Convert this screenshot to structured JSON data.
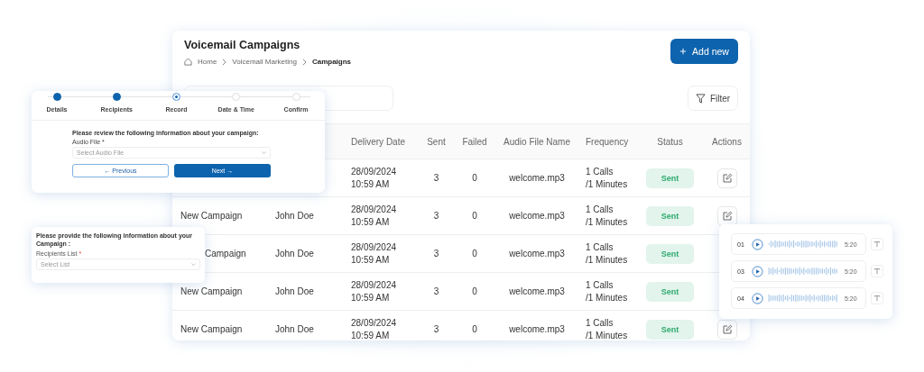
{
  "page": {
    "title": "Voicemail Campaigns",
    "breadcrumb": [
      {
        "label": "Home",
        "selected": false
      },
      {
        "label": "Voicemail  Marketing",
        "selected": false
      },
      {
        "label": "Campaigns",
        "selected": true
      }
    ],
    "add_button": "Add new",
    "filter_button": "Filter"
  },
  "table": {
    "columns": [
      "Delivery Date",
      "Sent",
      "Failed",
      "Audio File Name",
      "Frequency",
      "Status",
      "Actions"
    ],
    "rows": [
      {
        "date": "28/09/2024",
        "time": "10:59 AM",
        "sent": "3",
        "failed": "0",
        "audio": "welcome.mp3",
        "freq1": "1 Calls",
        "freq2": "/1 Minutes",
        "status": "Sent",
        "edit_shown": true
      },
      {
        "name": "New Campaign",
        "created_by": "John Doe",
        "date": "28/09/2024",
        "time": "10:59 AM",
        "sent": "3",
        "failed": "0",
        "audio": "welcome.mp3",
        "freq1": "1 Calls",
        "freq2": "/1 Minutes",
        "status": "Sent",
        "edit_shown": true
      },
      {
        "name": "Campaign",
        "name_cut": true,
        "created_by": "John Doe",
        "date": "28/09/2024",
        "time": "10:59 AM",
        "sent": "3",
        "failed": "0",
        "audio": "welcome.mp3",
        "freq1": "1 Calls",
        "freq2": "/1 Minutes",
        "status": "Sent",
        "edit_shown": false
      },
      {
        "name": "New Campaign",
        "created_by": "John Doe",
        "date": "28/09/2024",
        "time": "10:59 AM",
        "sent": "3",
        "failed": "0",
        "audio": "welcome.mp3",
        "freq1": "1 Calls",
        "freq2": "/1 Minutes",
        "status": "Sent",
        "edit_shown": false
      },
      {
        "name": "New Campaign",
        "created_by": "John Doe",
        "date": "28/09/2024",
        "time": "10:59 AM",
        "sent": "3",
        "failed": "0",
        "audio": "welcome.mp3",
        "freq1": "1 Calls",
        "freq2": "/1 Minutes",
        "status": "Sent",
        "edit_shown": true
      }
    ]
  },
  "wizard": {
    "steps": [
      {
        "label": "Details",
        "completed": true,
        "selected": false
      },
      {
        "label": "Recipients",
        "completed": true,
        "selected": false
      },
      {
        "label": "Record",
        "completed": false,
        "selected": true
      },
      {
        "label": "Date & Time",
        "completed": false,
        "selected": false
      },
      {
        "label": "Confirm",
        "completed": false,
        "selected": false
      }
    ],
    "prompt": "Please review the following information about your campaign:",
    "field_label": "Audio File *",
    "placeholder": "Select Audio File",
    "previous_button": "← Previous",
    "next_button": "Next →"
  },
  "recipients_form": {
    "prompt": "Please provide the following information about your Campaign :",
    "field_label": "Recipients List",
    "required_mark": "*",
    "placeholder": "Select List"
  },
  "audio_list": [
    {
      "number": "01",
      "duration": "5:20"
    },
    {
      "number": "03",
      "duration": "5:20"
    },
    {
      "number": "04",
      "duration": "5:20"
    }
  ]
}
